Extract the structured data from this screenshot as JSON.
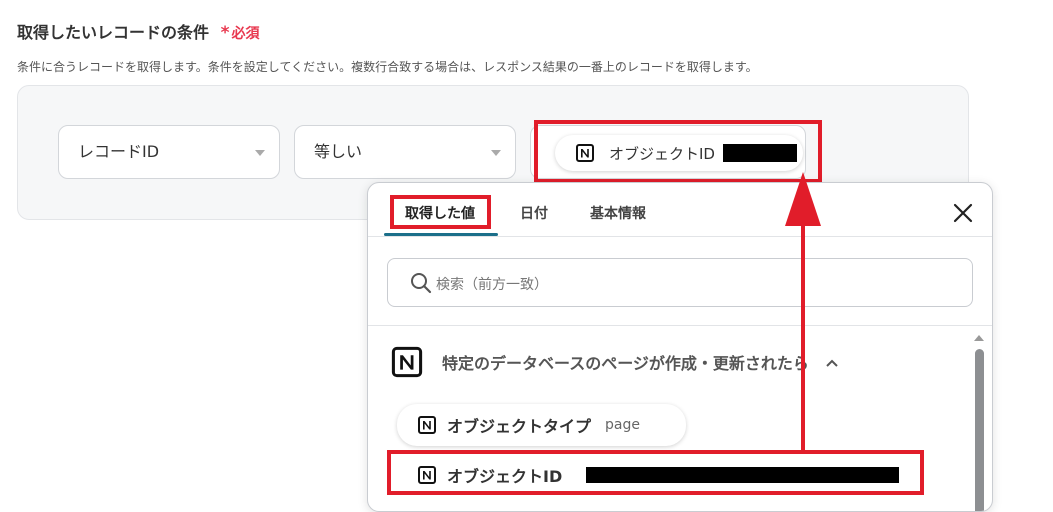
{
  "header": {
    "title": "取得したいレコードの条件",
    "required_mark": "*",
    "required_label": "必須",
    "description": "条件に合うレコードを取得します。条件を設定してください。複数行合致する場合は、レスポンス結果の一番上のレコードを取得します。"
  },
  "condition": {
    "field_select": "レコードID",
    "operator_select": "等しい",
    "value_chip_label": "オブジェクトID"
  },
  "popup": {
    "tabs": [
      {
        "label": "取得した値"
      },
      {
        "label": "日付"
      },
      {
        "label": "基本情報"
      }
    ],
    "search_placeholder": "検索（前方一致）",
    "group_title": "特定のデータベースのページが作成・更新されたら",
    "items": [
      {
        "label": "オブジェクトタイプ",
        "value": "page"
      },
      {
        "label": "オブジェクトID",
        "value": ""
      }
    ]
  },
  "colors": {
    "highlight": "#e11d2a",
    "required": "#e8384f",
    "tab_active": "#1b6f8a"
  }
}
